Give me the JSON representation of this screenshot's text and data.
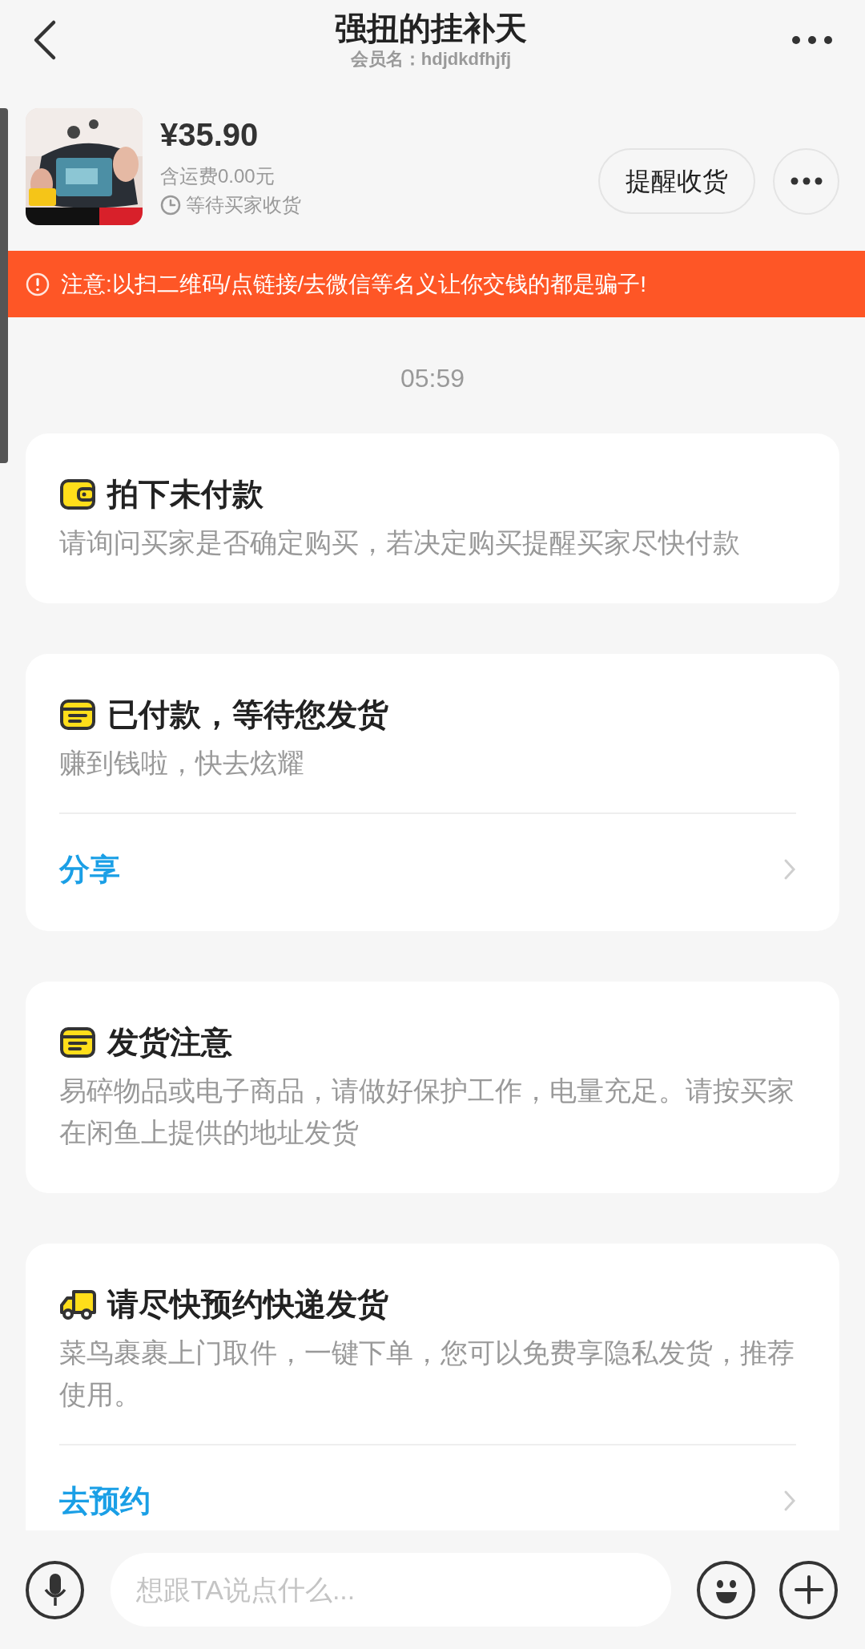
{
  "header": {
    "title": "强扭的挂补天",
    "member_name": "会员名：hdjdkdfhjfj"
  },
  "product": {
    "price": "¥35.90",
    "shipping": "含运费0.00元",
    "status": "等待买家收货",
    "action": "提醒收货"
  },
  "warning": "注意:以扫二维码/点链接/去微信等名义让你交钱的都是骗子!",
  "timestamp": "05:59",
  "cards": [
    {
      "kind": "wallet",
      "title": "拍下未付款",
      "description": "请询问买家是否确定购买，若决定购买提醒买家尽快付款"
    },
    {
      "kind": "note",
      "title": "已付款，等待您发货",
      "description": "赚到钱啦，快去炫耀",
      "link": "分享"
    },
    {
      "kind": "note",
      "title": "发货注意",
      "description": "易碎物品或电子商品，请做好保护工作，电量充足。请按买家在闲鱼上提供的地址发货"
    },
    {
      "kind": "truck",
      "title": "请尽快预约快递发货",
      "description": "菜鸟裹裹上门取件，一键下单，您可以免费享隐私发货，推荐使用。",
      "link": "去预约"
    }
  ],
  "input": {
    "placeholder": "想跟TA说点什么..."
  }
}
